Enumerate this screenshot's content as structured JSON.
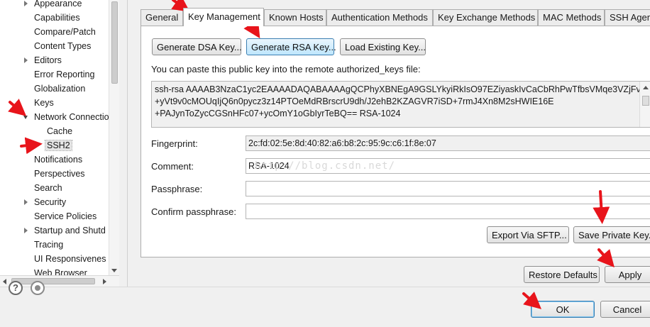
{
  "tree": {
    "items": [
      {
        "label": "Appearance",
        "twisty": "collapsed"
      },
      {
        "label": "Capabilities",
        "twisty": "none"
      },
      {
        "label": "Compare/Patch",
        "twisty": "none"
      },
      {
        "label": "Content Types",
        "twisty": "none"
      },
      {
        "label": "Editors",
        "twisty": "collapsed"
      },
      {
        "label": "Error Reporting",
        "twisty": "none"
      },
      {
        "label": "Globalization",
        "twisty": "none"
      },
      {
        "label": "Keys",
        "twisty": "none"
      },
      {
        "label": "Network Connectio",
        "twisty": "expanded"
      },
      {
        "label": "Cache",
        "twisty": "child"
      },
      {
        "label": "SSH2",
        "twisty": "child",
        "selected": true
      },
      {
        "label": "Notifications",
        "twisty": "none"
      },
      {
        "label": "Perspectives",
        "twisty": "none"
      },
      {
        "label": "Search",
        "twisty": "none"
      },
      {
        "label": "Security",
        "twisty": "collapsed"
      },
      {
        "label": "Service Policies",
        "twisty": "none"
      },
      {
        "label": "Startup and Shutd",
        "twisty": "collapsed"
      },
      {
        "label": "Tracing",
        "twisty": "none"
      },
      {
        "label": "UI Responsivenes",
        "twisty": "none"
      },
      {
        "label": "Web Browser",
        "twisty": "none"
      }
    ]
  },
  "tabs": [
    "General",
    "Key Management",
    "Known Hosts",
    "Authentication Methods",
    "Key Exchange Methods",
    "MAC Methods",
    "SSH Agen"
  ],
  "active_tab": "Key Management",
  "key_buttons": {
    "generate_dsa": "Generate DSA Key...",
    "generate_rsa": "Generate RSA Key...",
    "load_existing": "Load Existing Key..."
  },
  "paste_hint": "You can paste this public key into the remote authorized_keys file:",
  "public_key_lines": [
    "ssh-rsa AAAAB3NzaC1yc2EAAAADAQABAAAAgQCPhyXBNEgA9GSLYkyiRkIsO97EZiyaskIvCaCbRhPwTfbsVMqe3VZjFv",
    "+yVt9v0cMOUqIjQ6n0pycz3z14PTOeMdRBrscrU9dh/J2ehB2KZAGVR7iSD+7rmJ4Xn8M2sHWIE16E",
    "+PAJynToZycCGSnHFc07+ycOmY1oGbIyrTeBQ== RSA-1024"
  ],
  "fields": {
    "fingerprint_label": "Fingerprint:",
    "fingerprint_value": "2c:fd:02:5e:8d:40:82:a6:b8:2c:95:9c:c6:1f:8e:07",
    "comment_label": "Comment:",
    "comment_value": "RSA-1024",
    "passphrase_label": "Passphrase:",
    "passphrase_value": "",
    "confirm_label": "Confirm passphrase:",
    "confirm_value": ""
  },
  "watermark": "http://blog.csdn.net/",
  "export_sftp": "Export Via SFTP...",
  "save_private": "Save Private Key...",
  "restore_defaults": "Restore Defaults",
  "apply": "Apply",
  "ok": "OK",
  "cancel": "Cancel",
  "colors": {
    "annotation_arrow": "#e8141b",
    "selection": "#e4e4e4",
    "accent_border": "#3c7fb1"
  }
}
